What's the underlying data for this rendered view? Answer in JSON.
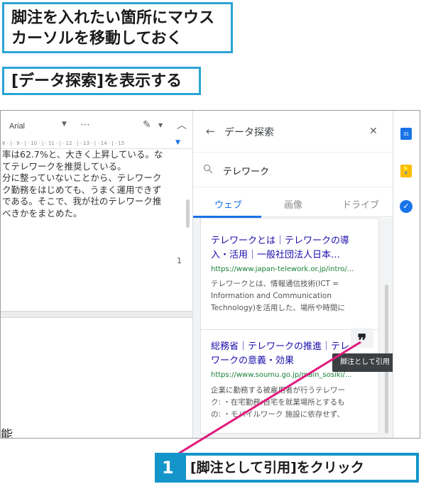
{
  "callouts": {
    "move_cursor_line1": "脚注を入れたい箇所にマウス",
    "move_cursor_line2": "カーソルを移動しておく",
    "show_explore": "[データ探索]を表示する"
  },
  "doc": {
    "toolbar": {
      "font": "Arial",
      "more": "⋯"
    },
    "ruler": "8 · | · 9 · | · 10 · | · 11 · | · 12 · | · 13 · | · 14 · | · 15",
    "text_lines": [
      "率は62.7%と、大きく上昇している。な",
      "てテレワークを推奨している。",
      "分に整っていないことから、テレワーク",
      "ク勤務をはじめても、うまく運用できず",
      "である。そこで、我が社のテレワーク推",
      "べきかをまとめた。"
    ],
    "page_number": "1",
    "bottom_text": "能"
  },
  "panel": {
    "title": "データ探索",
    "search_value": "テレワーク",
    "tabs": [
      "ウェブ",
      "画像",
      "ドライブ"
    ],
    "results": [
      {
        "title_line1": "テレワークとは｜テレワークの導",
        "title_line2": "入・活用｜一般社団法人日本…",
        "url": "https://www.japan-telework.or.jp/intro/...",
        "snippet": [
          "テレワークとは、情報通信技術(ICT =",
          "Information and Communication",
          "Technology)を活用した、場所や時間に"
        ]
      },
      {
        "title_line1": "総務省｜テレワークの推進｜テレ",
        "title_line2": "ワークの意義・効果",
        "url": "https://www.soumu.go.jp/main_sosiki/...",
        "snippet": [
          "企業に勤務する被雇用者が行うテレワー",
          "ク: ・在宅勤務:自宅を就業場所とするも",
          "の: ・モバイルワーク 施設に依存せず、"
        ]
      }
    ],
    "cite_glyph": "❞",
    "tooltip": "脚注として引用"
  },
  "rail": {
    "calendar": "31",
    "keep": "💡",
    "tasks": "✓"
  },
  "step": {
    "number": "1",
    "label": "[脚注として引用]をクリック"
  },
  "colors": {
    "callout_border": "#2aa4d5",
    "step_bg": "#1495c9",
    "pointer": "#e0197d",
    "link": "#1a0dab",
    "url": "#188038",
    "accent": "#1a73e8"
  }
}
